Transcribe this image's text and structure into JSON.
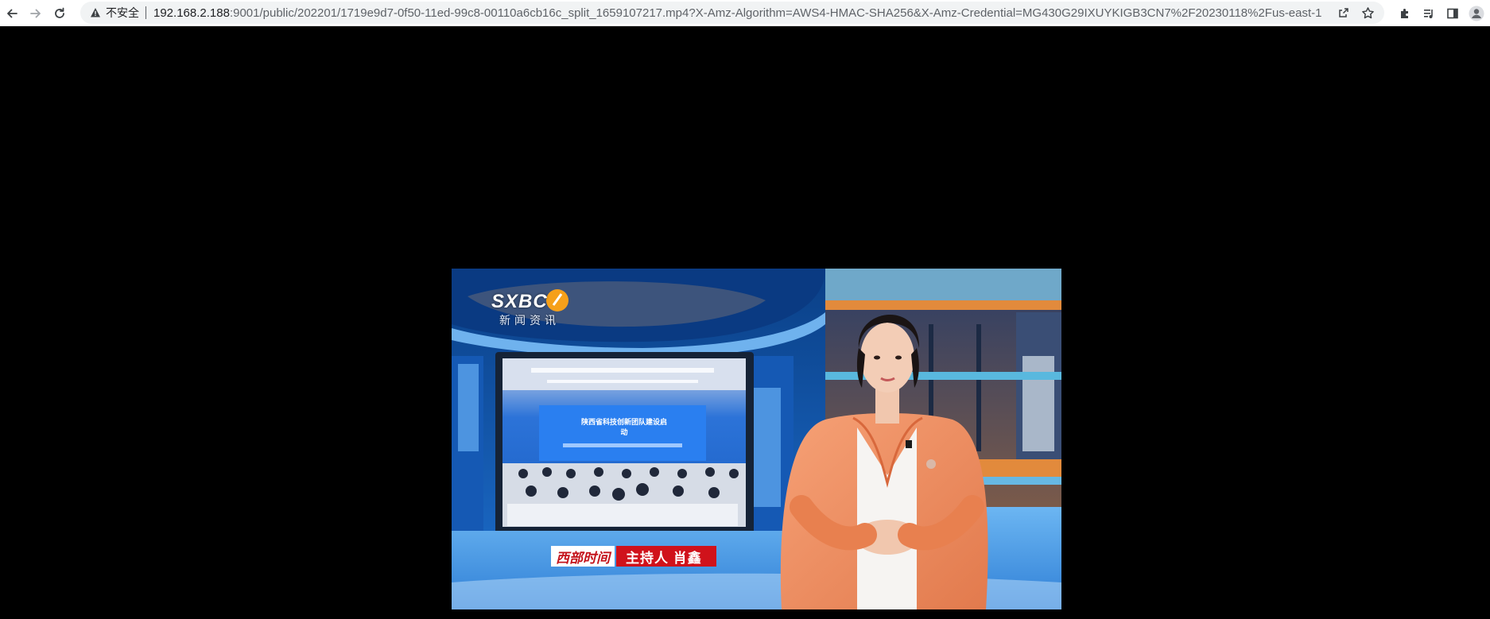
{
  "browser": {
    "security_label": "不安全",
    "url_host": "192.168.2.188",
    "url_rest": ":9001/public/202201/1719e9d7-0f50-11ed-99c8-00110a6cb16c_split_1659107217.mp4?X-Amz-Algorithm=AWS4-HMAC-SHA256&X-Amz-Credential=MG430G29IXUYKIGB3CN7%2F20230118%2Fus-east-1...",
    "icons": [
      "back-icon",
      "forward-icon",
      "reload-icon",
      "warning-icon",
      "share-icon",
      "star-icon",
      "extensions-icon",
      "media-control-icon",
      "side-panel-icon",
      "profile-icon"
    ]
  },
  "video": {
    "logo_text": "SXBC",
    "logo_subtitle": "新闻资讯",
    "screen_title": "陕西省科技创新团队建设启动",
    "program_name": "西部时间",
    "anchor_caption": "主持人 肖鑫",
    "colors": {
      "studio_blue": "#0b4d9a",
      "caption_red": "#d0121b",
      "jacket": "#f08a5d"
    }
  }
}
